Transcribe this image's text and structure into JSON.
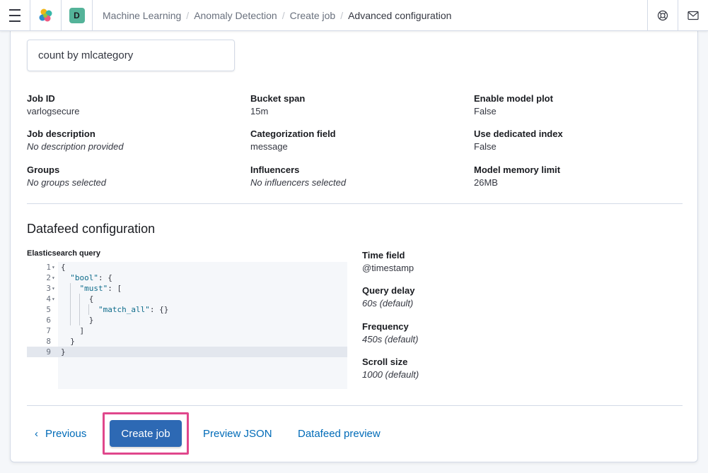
{
  "header": {
    "menu_icon": "hamburger-icon",
    "logo_icon": "elastic-logo-icon",
    "space_initial": "D",
    "breadcrumbs": [
      "Machine Learning",
      "Anomaly Detection",
      "Create job",
      "Advanced configuration"
    ],
    "help_icon": "help-lifebuoy-icon",
    "mail_icon": "mail-icon"
  },
  "detector": "count by mlcategory",
  "job_summary": {
    "job_id": {
      "label": "Job ID",
      "value": "varlogsecure"
    },
    "job_description": {
      "label": "Job description",
      "value": "No description provided"
    },
    "groups": {
      "label": "Groups",
      "value": "No groups selected"
    },
    "bucket_span": {
      "label": "Bucket span",
      "value": "15m"
    },
    "categorization_field": {
      "label": "Categorization field",
      "value": "message"
    },
    "influencers": {
      "label": "Influencers",
      "value": "No influencers selected"
    },
    "enable_model_plot": {
      "label": "Enable model plot",
      "value": "False"
    },
    "use_dedicated_index": {
      "label": "Use dedicated index",
      "value": "False"
    },
    "model_memory_limit": {
      "label": "Model memory limit",
      "value": "26MB"
    }
  },
  "datafeed": {
    "title": "Datafeed configuration",
    "query_label": "Elasticsearch query",
    "query_lines": [
      "{",
      "  \"bool\": {",
      "    \"must\": [",
      "      {",
      "        \"match_all\": {}",
      "      }",
      "    ]",
      "  }",
      "}"
    ],
    "time_field": {
      "label": "Time field",
      "value": "@timestamp"
    },
    "query_delay": {
      "label": "Query delay",
      "value": "60s (default)"
    },
    "frequency": {
      "label": "Frequency",
      "value": "450s (default)"
    },
    "scroll_size": {
      "label": "Scroll size",
      "value": "1000 (default)"
    }
  },
  "footer": {
    "previous_label": "Previous",
    "create_label": "Create job",
    "preview_json_label": "Preview JSON",
    "datafeed_preview_label": "Datafeed preview"
  },
  "colors": {
    "primary": "#2d69b4",
    "link": "#006bb8",
    "highlight_border": "#e0478c",
    "space_badge": "#54b399"
  }
}
